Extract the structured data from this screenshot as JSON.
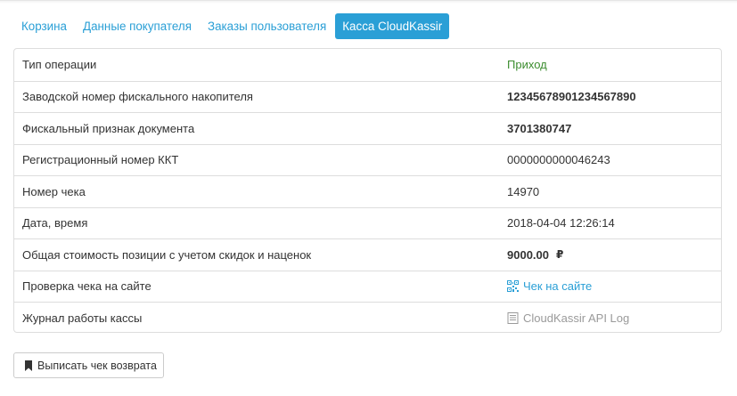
{
  "tabs": [
    {
      "label": "Корзина",
      "active": false
    },
    {
      "label": "Данные покупателя",
      "active": false
    },
    {
      "label": "Заказы пользователя",
      "active": false
    },
    {
      "label": "Касса CloudKassir",
      "active": true
    }
  ],
  "receipt": {
    "operation_type": {
      "label": "Тип операции",
      "value": "Приход"
    },
    "fiscal_storage_number": {
      "label": "Заводской номер фискального накопителя",
      "value": "12345678901234567890"
    },
    "fiscal_sign": {
      "label": "Фискальный признак документа",
      "value": "3701380747"
    },
    "kkt_reg_number": {
      "label": "Регистрационный номер ККТ",
      "value": "0000000000046243"
    },
    "receipt_number": {
      "label": "Номер чека",
      "value": "14970"
    },
    "datetime": {
      "label": "Дата, время",
      "value": "2018-04-04 12:26:14"
    },
    "total": {
      "label": "Общая стоимость позиции с учетом скидок и наценок",
      "value": "9000.00",
      "currency": "₽"
    },
    "check_online": {
      "label": "Проверка чека на сайте",
      "link": "Чек на сайте",
      "icon": "qrcode-icon"
    },
    "kassa_log": {
      "label": "Журнал работы кассы",
      "link": "CloudKassir API Log",
      "icon": "list-icon"
    }
  },
  "actions": {
    "refund_button": "Выписать чек возврата",
    "refund_icon": "bookmark-icon"
  },
  "colors": {
    "accent": "#2a9fd6",
    "income": "#3c8d2f",
    "muted": "#9a9a9a",
    "border": "#dddddd"
  }
}
